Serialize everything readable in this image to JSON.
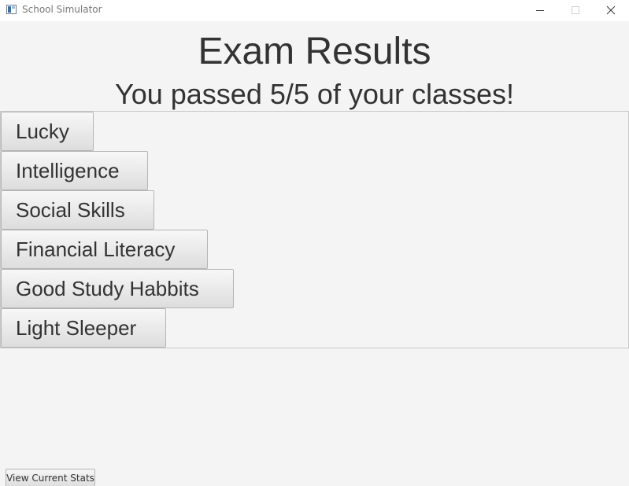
{
  "window": {
    "title": "School Simulator",
    "icon": "app-window-icon",
    "controls": [
      "minimize-icon",
      "maximize-icon",
      "close-icon"
    ]
  },
  "main": {
    "title": "Exam Results",
    "result": "You passed 5/5 of your classes!",
    "traits": [
      {
        "label": "Lucky"
      },
      {
        "label": "Intelligence"
      },
      {
        "label": "Social Skills"
      },
      {
        "label": "Financial Literacy"
      },
      {
        "label": "Good Study Habbits"
      },
      {
        "label": "Light Sleeper"
      }
    ]
  },
  "footer": {
    "view_stats_label": "View Current Stats"
  },
  "colors": {
    "background": "#f4f4f4",
    "text": "#333333",
    "button_border": "#b5b5b5"
  }
}
